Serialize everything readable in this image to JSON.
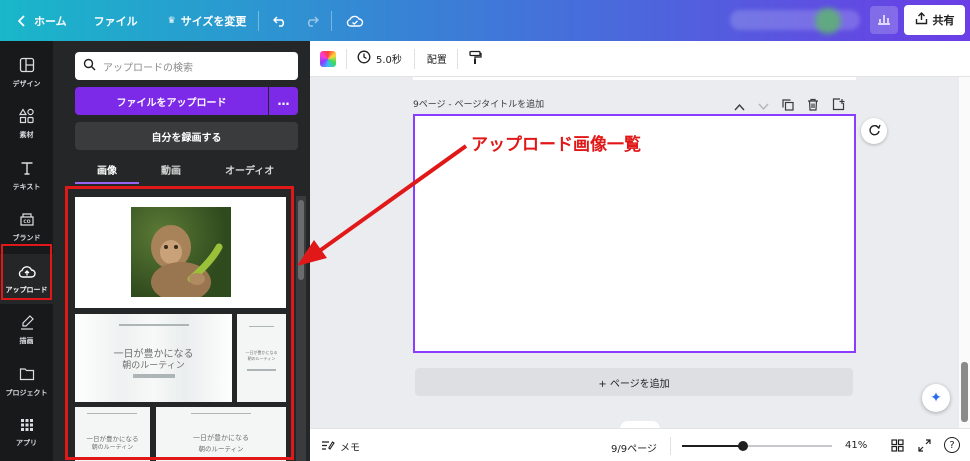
{
  "topbar": {
    "home": "ホーム",
    "file": "ファイル",
    "resize": "サイズを変更",
    "share": "共有"
  },
  "rail": {
    "items": [
      {
        "label": "デザイン"
      },
      {
        "label": "素材"
      },
      {
        "label": "テキスト"
      },
      {
        "label": "ブランド"
      },
      {
        "label": "アップロード"
      },
      {
        "label": "描画"
      },
      {
        "label": "プロジェクト"
      },
      {
        "label": "アプリ"
      }
    ]
  },
  "panel": {
    "search_placeholder": "アップロードの検索",
    "upload_button": "ファイルをアップロード",
    "more": "…",
    "record_button": "自分を録画する",
    "tabs": [
      "画像",
      "動画",
      "オーディオ"
    ],
    "thumb_a_lines": [
      "一日が豊かになる",
      "朝のルーティン"
    ],
    "thumb_b_lines": [
      "一日が豊かになる",
      "朝のルーティン"
    ],
    "thumb_c_lines": [
      "一日が豊かになる",
      "朝のルーティン"
    ]
  },
  "toolbar": {
    "duration": "5.0秒",
    "arrange": "配置"
  },
  "canvas": {
    "page_label": "9ページ - ページタイトルを追加",
    "add_page": "+ ページを追加"
  },
  "bottom": {
    "notes": "メモ",
    "page_count": "9/9ページ",
    "zoom": "41%",
    "zoom_level": 0.41
  },
  "annotation": {
    "text": "アップロード画像一覧",
    "color": "#e01818"
  },
  "colors": {
    "accent": "#7d2ae8",
    "highlight": "#e01818"
  }
}
